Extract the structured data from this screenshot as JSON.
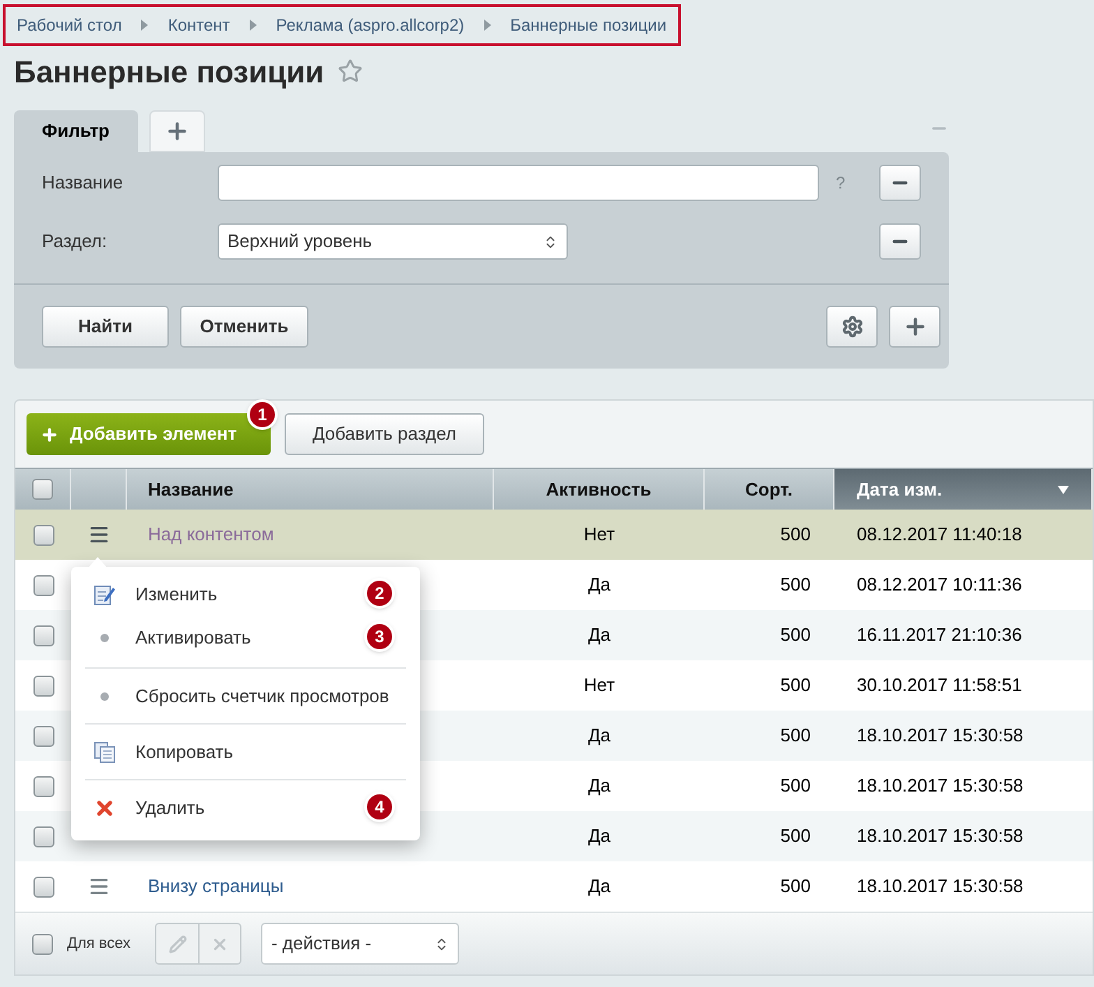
{
  "breadcrumbs": [
    "Рабочий стол",
    "Контент",
    "Реклама (aspro.allcorp2)",
    "Баннерные позиции"
  ],
  "title": "Баннерные позиции",
  "filter": {
    "tabs": [
      {
        "label": "Фильтр",
        "selected": true
      },
      {
        "kind": "add",
        "selected": false
      }
    ],
    "fields": [
      {
        "kind": "text",
        "label": "Название",
        "help": "?"
      },
      {
        "kind": "select",
        "label": "Раздел:",
        "value": "Верхний уровень"
      }
    ],
    "buttons": [
      "Найти",
      "Отменить"
    ]
  },
  "toolbar": {
    "add_element": {
      "label": "Добавить элемент",
      "badge": "1"
    },
    "add_section": "Добавить раздел"
  },
  "table": {
    "select_all_checked": false,
    "columns": [
      {
        "label": "Название",
        "sorted": false
      },
      {
        "label": "Активность",
        "sorted": false
      },
      {
        "label": "Сорт.",
        "sorted": false
      },
      {
        "label": "Дата изм.",
        "sorted": true
      }
    ],
    "rows": [
      {
        "name": "Над контентом",
        "active": "Нет",
        "sort": "500",
        "date": "08.12.2017 11:40:18",
        "selected": true,
        "checked": false
      },
      {
        "active": "Да",
        "sort": "500",
        "date": "08.12.2017 10:11:36",
        "selected": false,
        "checked": false
      },
      {
        "active": "Да",
        "sort": "500",
        "date": "16.11.2017 21:10:36",
        "selected": false,
        "checked": false
      },
      {
        "active": "Нет",
        "sort": "500",
        "date": "30.10.2017 11:58:51",
        "selected": false,
        "checked": false
      },
      {
        "active": "Да",
        "sort": "500",
        "date": "18.10.2017 15:30:58",
        "selected": false,
        "checked": false
      },
      {
        "active": "Да",
        "sort": "500",
        "date": "18.10.2017 15:30:58",
        "selected": false,
        "checked": false
      },
      {
        "active": "Да",
        "sort": "500",
        "date": "18.10.2017 15:30:58",
        "selected": false,
        "checked": false
      },
      {
        "name": "Внизу страницы",
        "active": "Да",
        "sort": "500",
        "date": "18.10.2017 15:30:58",
        "selected": false,
        "checked": false
      }
    ]
  },
  "context_menu": {
    "groups": [
      [
        {
          "kind": "edit",
          "label": "Изменить",
          "badge": "2"
        },
        {
          "kind": "dot",
          "label": "Активировать",
          "badge": "3"
        }
      ],
      [
        {
          "kind": "dot",
          "label": "Сбросить счетчик просмотров"
        }
      ],
      [
        {
          "kind": "copy",
          "label": "Копировать"
        }
      ],
      [
        {
          "kind": "delete",
          "label": "Удалить",
          "badge": "4"
        }
      ]
    ]
  },
  "footer": {
    "for_all_checked": false,
    "for_all": "Для всех",
    "actions_select": "- действия -"
  }
}
